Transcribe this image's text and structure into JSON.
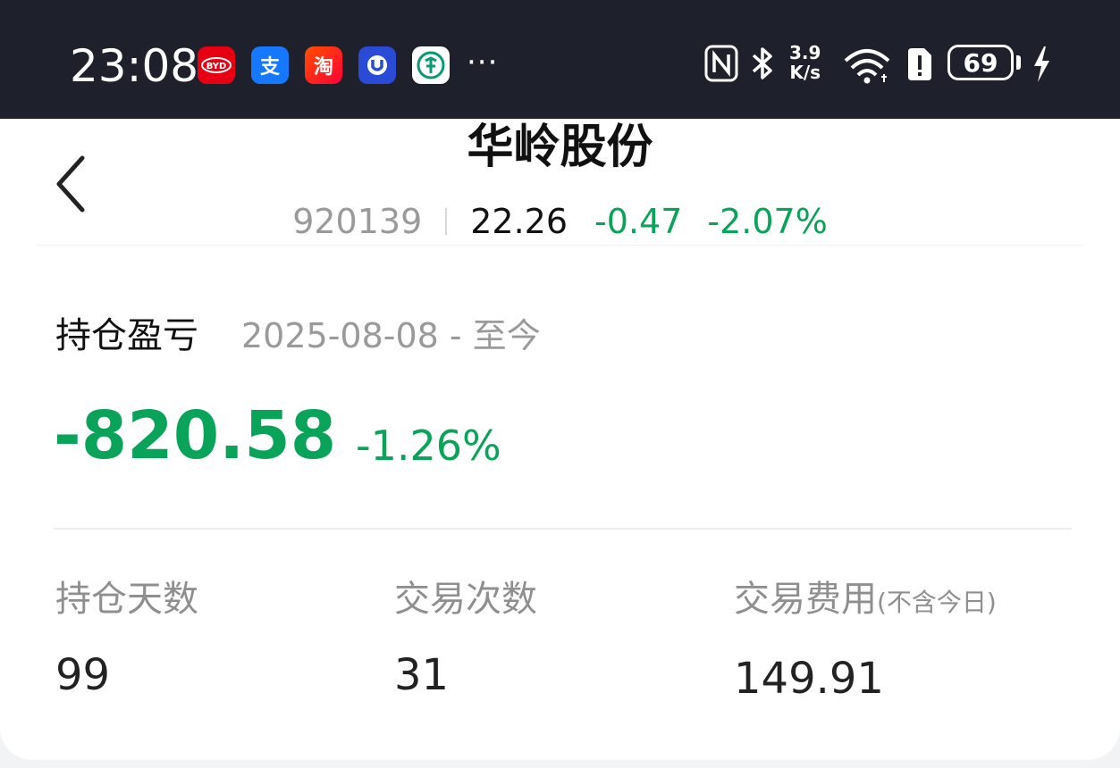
{
  "status_bar": {
    "time": "23:08",
    "app_icons": [
      "byd-icon",
      "alipay-icon",
      "taobao-icon",
      "ucard-icon",
      "abc-bank-icon"
    ],
    "byd_text": "BYD",
    "alipay_text": "支",
    "taobao_text": "淘",
    "more": "···",
    "net_speed_value": "3.9",
    "net_speed_unit": "K/s",
    "battery": "69"
  },
  "header": {
    "stock_name": "华岭股份",
    "code": "920139",
    "price": "22.26",
    "change": "-0.47",
    "change_pct": "-2.07%"
  },
  "position": {
    "label": "持仓盈亏",
    "date_range": "2025-08-08 - 至今",
    "pnl_value": "-820.58",
    "pnl_pct": "-1.26%"
  },
  "stats": [
    {
      "label": "持仓天数",
      "note": "",
      "value": "99"
    },
    {
      "label": "交易次数",
      "note": "",
      "value": "31"
    },
    {
      "label": "交易费用",
      "note": "(不含今日)",
      "value": "149.91"
    }
  ],
  "colors": {
    "down": "#0aa35a",
    "status_bar_bg": "#1e212b",
    "muted": "#9a9a9a"
  }
}
